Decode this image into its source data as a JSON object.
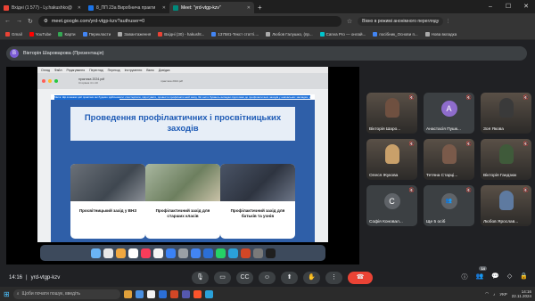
{
  "browser": {
    "tabs": [
      {
        "title": "Вхідні (1 577) - Ly.hakushko@",
        "favicon_color": "#ea4335",
        "active": false
      },
      {
        "title": "8_ПП 23а Виробнича практи",
        "favicon_color": "#1a73e8",
        "active": false
      },
      {
        "title": "Meet: \"yrd-vtgp-kzv\"",
        "favicon_color": "#00897b",
        "active": true
      }
    ],
    "new_tab": "+",
    "url": "meet.google.com/yrd-vtgp-kzv?authuser=0",
    "incognito_label": "Вікно в режимі анонімного перегляду"
  },
  "bookmarks": [
    {
      "label": "Gmail",
      "color": "#ea4335"
    },
    {
      "label": "YouTube",
      "color": "#ff0000"
    },
    {
      "label": "Карти",
      "color": "#34a853"
    },
    {
      "label": "Перекласти",
      "color": "#4285f4"
    },
    {
      "label": "Завантаження",
      "color": "#aaaaaa"
    },
    {
      "label": "Вхідні (30) - hakusht...",
      "color": "#ea4335"
    },
    {
      "label": "137581-Текст статті....",
      "color": "#4285f4"
    },
    {
      "label": "Любов Галушко, (пр...",
      "color": "#aaaaaa"
    },
    {
      "label": "Canva Pro — онлай...",
      "color": "#00c4cc"
    },
    {
      "label": "посібник_Основи п...",
      "color": "#4285f4"
    },
    {
      "label": "Нова вкладка",
      "color": "#aaaaaa"
    }
  ],
  "presenter": {
    "initial": "В",
    "label": "Вікторія Шароварова (Презентація)"
  },
  "shared_screen": {
    "mac_menu": [
      "Огляд",
      "Файл",
      "Редагування",
      "Перегляд",
      "Переход",
      "Інструменти",
      "Вікно",
      "Довідка"
    ],
    "window_title": "практика 2024.pdf",
    "window_subtitle": "Сторінка 4 із 10",
    "window_center": "практика 2024.pdf",
    "top_text": "Мета: Що в межах цієї практики ми будемо здійснювати: спостерігати, підготувати, провести профілактичний захід. Як часто бувають випадки підготовки до профілактичних заходів у навчальних закладах, у тому числі профілактичних бесід, що проводяться...",
    "slide_title": "Проведення профілактичних і просвітницьких заходів",
    "cards": [
      {
        "caption": "Просвітницький захід у ВНЗ"
      },
      {
        "caption": "Профілактичний захід для старших класів"
      },
      {
        "caption": "Профілактичний захід для батьків та учнів"
      }
    ]
  },
  "participants": [
    {
      "name": "Вікторія Шаро...",
      "initial": "",
      "color": "#6f5040"
    },
    {
      "name": "Анастасія Пушк...",
      "initial": "А",
      "color": "#8e6ccc"
    },
    {
      "name": "Зоя Якова",
      "initial": "",
      "color": "#3a3a3a"
    },
    {
      "name": "Олеся Жукова",
      "initial": "",
      "color": "#c9a06a"
    },
    {
      "name": "Тетяна Старці...",
      "initial": "",
      "color": "#7a5a4a"
    },
    {
      "name": "Вікторія Гандзюк",
      "initial": "",
      "color": "#3f5a3a"
    },
    {
      "name": "Софія Коновал...",
      "initial": "С",
      "color": "#5f6368"
    },
    {
      "name": "Ще 5 осіб",
      "initial": "",
      "color": "#5f6368"
    },
    {
      "name": "Любов Ярослав...",
      "initial": "",
      "color": "#5e7aa0"
    }
  ],
  "meet": {
    "time": "14:16",
    "separator": "|",
    "code": "yrd-vtgp-kzv",
    "participants_count": "14"
  },
  "taskbar": {
    "search_placeholder": "Щоби почати пошук, введіть",
    "lang": "УКР",
    "time": "14:16",
    "date": "22.11.2024"
  },
  "colors": {
    "end_call": "#ea4335",
    "slide_bg": "#2f5fa8",
    "slide_title": "#1d5ab5"
  }
}
